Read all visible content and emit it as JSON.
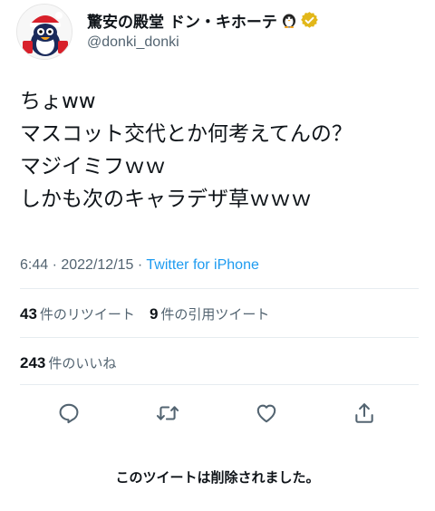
{
  "account": {
    "display_name": "驚安の殿堂 ドン・キホーテ",
    "handle": "@donki_donki",
    "verified": true
  },
  "tweet": {
    "lines": [
      "ちょww",
      "マスコット交代とか何考えてんの？",
      "マジイミフｗｗ",
      "しかも次のキャラデザ草ｗｗｗ"
    ],
    "time": "6:44",
    "separator": " · ",
    "date": "2022/12/15",
    "source": "Twitter for iPhone"
  },
  "stats": {
    "retweets_count": "43",
    "retweets_label": "件のリツイート",
    "quotes_count": "9",
    "quotes_label": "件の引用ツイート",
    "likes_count": "243",
    "likes_label": "件のいいね"
  },
  "actions": {
    "reply_icon": "reply-icon",
    "retweet_icon": "retweet-icon",
    "like_icon": "heart-icon",
    "share_icon": "share-icon"
  },
  "notice": "このツイートは削除されました。",
  "colors": {
    "link": "#1d9bf0",
    "muted": "#536471",
    "text": "#0f1419",
    "verified": "#e2b719"
  }
}
